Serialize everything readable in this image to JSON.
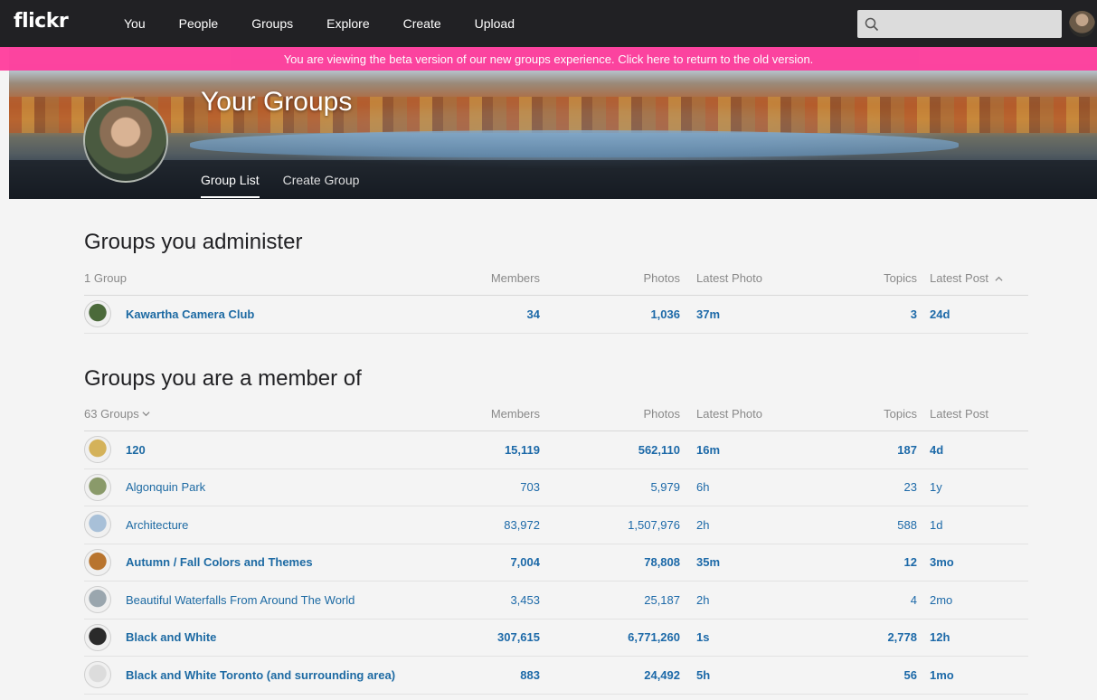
{
  "nav": {
    "logo": "flickr",
    "items": [
      "You",
      "People",
      "Groups",
      "Explore",
      "Create",
      "Upload"
    ],
    "search_placeholder": ""
  },
  "banner": {
    "text": "You are viewing the beta version of our new groups experience. Click here to return to the old version."
  },
  "hero": {
    "title": "Your Groups",
    "tabs": [
      "Group List",
      "Create Group"
    ]
  },
  "admin": {
    "title": "Groups you administer",
    "count_label": "1 Group",
    "headers": {
      "members": "Members",
      "photos": "Photos",
      "latest_photo": "Latest Photo",
      "topics": "Topics",
      "latest_post": "Latest Post"
    },
    "rows": [
      {
        "name": "Kawartha Camera Club",
        "members": "34",
        "photos": "1,036",
        "latest_photo": "37m",
        "topics": "3",
        "latest_post": "24d",
        "bold": true,
        "avatar_color": "#4b6a3a"
      }
    ]
  },
  "member": {
    "title": "Groups you are a member of",
    "count_label": "63 Groups",
    "headers": {
      "members": "Members",
      "photos": "Photos",
      "latest_photo": "Latest Photo",
      "topics": "Topics",
      "latest_post": "Latest Post"
    },
    "rows": [
      {
        "name": "120",
        "members": "15,119",
        "photos": "562,110",
        "latest_photo": "16m",
        "topics": "187",
        "latest_post": "4d",
        "bold": true,
        "avatar_color": "#d4b25a"
      },
      {
        "name": "Algonquin Park",
        "members": "703",
        "photos": "5,979",
        "latest_photo": "6h",
        "topics": "23",
        "latest_post": "1y",
        "bold": false,
        "avatar_color": "#8a9a6a"
      },
      {
        "name": "Architecture",
        "members": "83,972",
        "photos": "1,507,976",
        "latest_photo": "2h",
        "topics": "588",
        "latest_post": "1d",
        "bold": false,
        "avatar_color": "#a8c0d8"
      },
      {
        "name": "Autumn / Fall Colors and Themes",
        "members": "7,004",
        "photos": "78,808",
        "latest_photo": "35m",
        "topics": "12",
        "latest_post": "3mo",
        "bold": true,
        "avatar_color": "#b8742e"
      },
      {
        "name": "Beautiful Waterfalls From Around The World",
        "members": "3,453",
        "photos": "25,187",
        "latest_photo": "2h",
        "topics": "4",
        "latest_post": "2mo",
        "bold": false,
        "avatar_color": "#9aa6ae"
      },
      {
        "name": "Black and White",
        "members": "307,615",
        "photos": "6,771,260",
        "latest_photo": "1s",
        "topics": "2,778",
        "latest_post": "12h",
        "bold": true,
        "avatar_color": "#2a2a2a"
      },
      {
        "name": "Black and White Toronto (and surrounding area)",
        "members": "883",
        "photos": "24,492",
        "latest_photo": "5h",
        "topics": "56",
        "latest_post": "1mo",
        "bold": true,
        "avatar_color": "#dcdcdc"
      }
    ]
  },
  "colors": {
    "nav_bg": "#212124",
    "banner_bg": "#ff3c9c",
    "link": "#1c69a8",
    "page_bg": "#f4f4f4"
  }
}
